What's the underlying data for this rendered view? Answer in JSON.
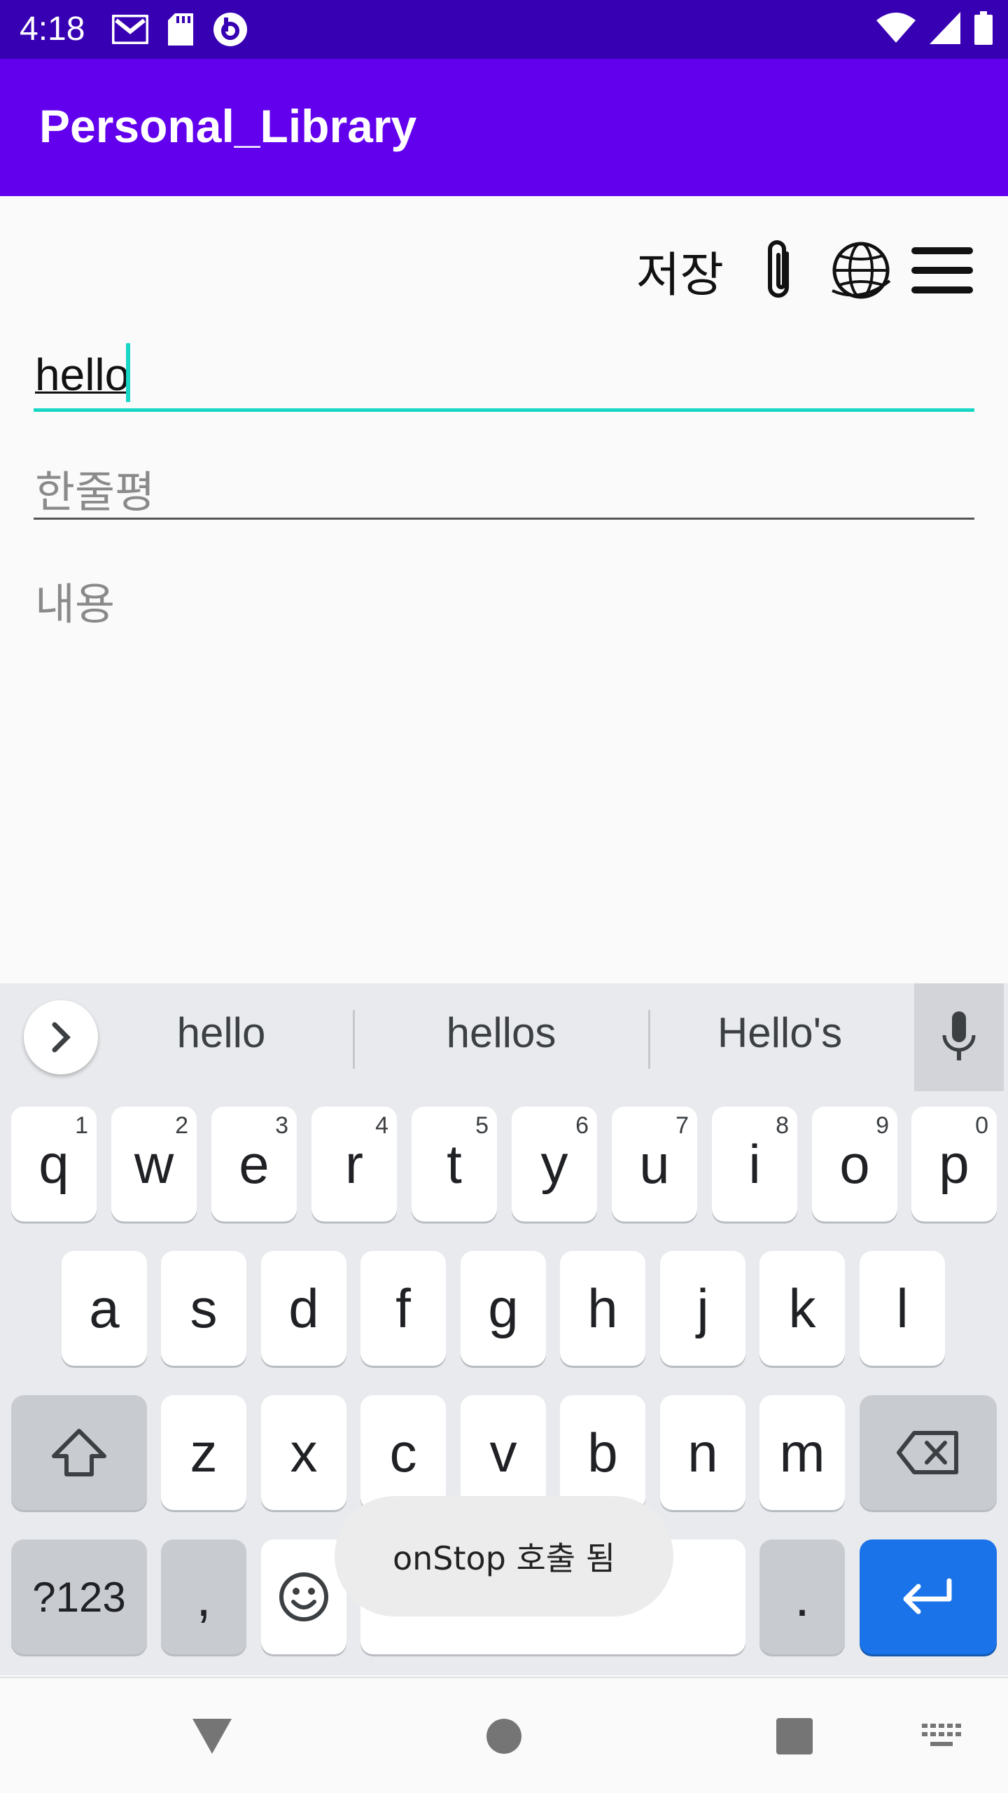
{
  "status_bar": {
    "time": "4:18",
    "left_icons": [
      "gmail-icon",
      "sd-card-icon",
      "app-notification-icon"
    ],
    "right_icons": [
      "wifi-icon",
      "signal-icon",
      "battery-icon"
    ]
  },
  "app_bar": {
    "title": "Personal_Library"
  },
  "toolbar": {
    "save_label": "저장",
    "icons": [
      "paperclip-icon",
      "globe-icon",
      "menu-icon"
    ]
  },
  "form": {
    "title_value": "hello",
    "review_placeholder": "한줄평",
    "content_placeholder": "내용"
  },
  "keyboard": {
    "suggestions": [
      "hello",
      "hellos",
      "Hello's"
    ],
    "row1": [
      {
        "key": "q",
        "hint": "1"
      },
      {
        "key": "w",
        "hint": "2"
      },
      {
        "key": "e",
        "hint": "3"
      },
      {
        "key": "r",
        "hint": "4"
      },
      {
        "key": "t",
        "hint": "5"
      },
      {
        "key": "y",
        "hint": "6"
      },
      {
        "key": "u",
        "hint": "7"
      },
      {
        "key": "i",
        "hint": "8"
      },
      {
        "key": "o",
        "hint": "9"
      },
      {
        "key": "p",
        "hint": "0"
      }
    ],
    "row2": [
      "a",
      "s",
      "d",
      "f",
      "g",
      "h",
      "j",
      "k",
      "l"
    ],
    "row3": [
      "z",
      "x",
      "c",
      "v",
      "b",
      "n",
      "m"
    ],
    "symbols_label": "?123",
    "comma_label": ",",
    "period_label": ".",
    "accent_color": "#1a73e8"
  },
  "toast": {
    "message": "onStop 호출 됨"
  },
  "colors": {
    "status_bar": "#3700b3",
    "app_bar": "#6200ee",
    "field_focus": "#18d6c6"
  }
}
